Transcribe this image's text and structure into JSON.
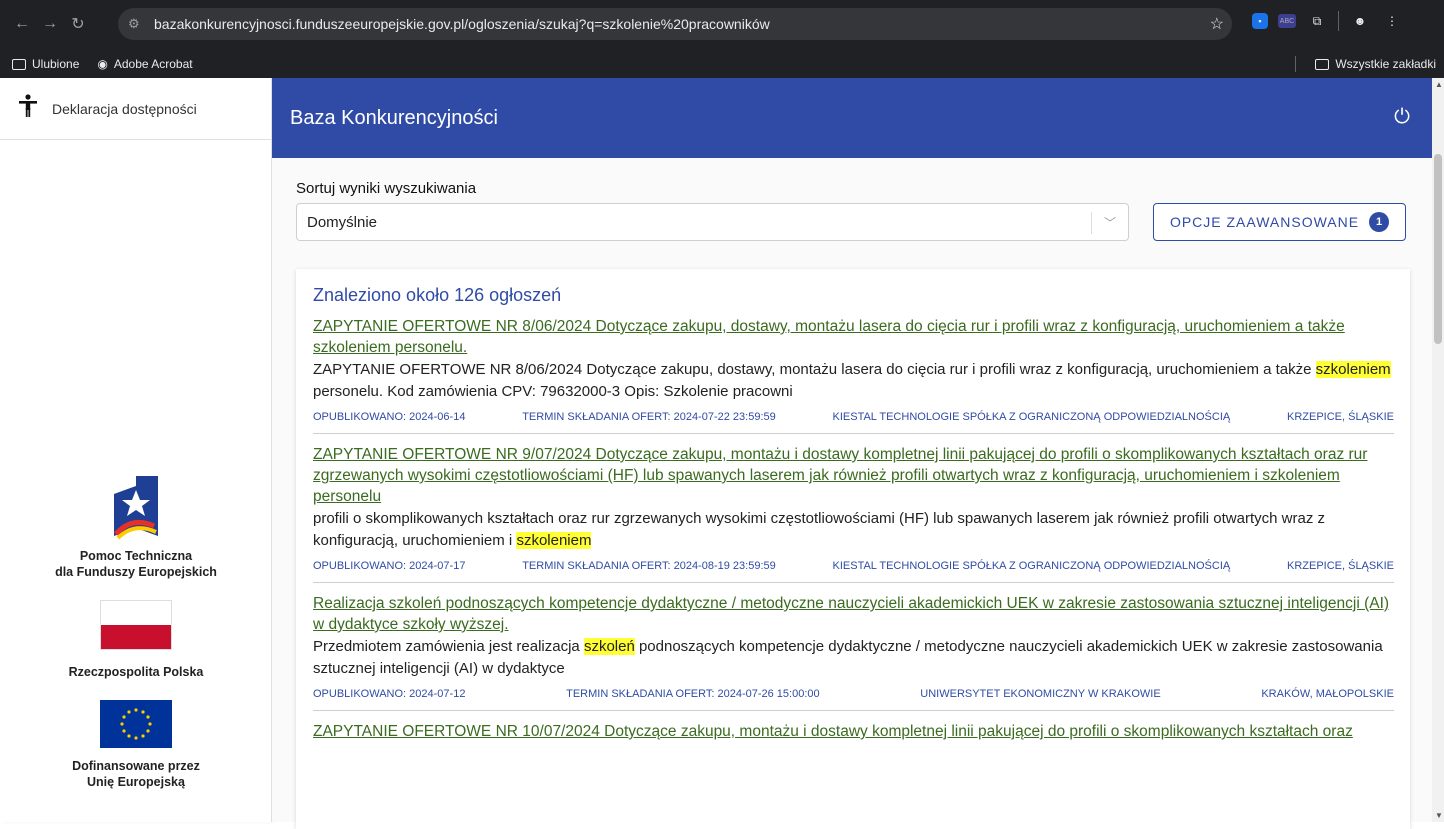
{
  "browser": {
    "url": "bazakonkurencyjnosci.funduszeeuropejskie.gov.pl/ogloszenia/szukaj?q=szkolenie%20pracowników",
    "bookmarks": [
      {
        "label": "Ulubione",
        "icon": "folder-icon"
      },
      {
        "label": "Adobe Acrobat",
        "icon": "adobe-acrobat-icon"
      }
    ],
    "all_bookmarks_label": "Wszystkie zakładki"
  },
  "sidebar": {
    "accessibility_label": "Deklaracja dostępności",
    "logos": [
      {
        "line1": "Pomoc Techniczna",
        "line2": "dla Funduszy Europejskich"
      },
      {
        "line1": "Rzeczpospolita Polska",
        "line2": ""
      },
      {
        "line1": "Dofinansowane przez",
        "line2": "Unię Europejską"
      }
    ]
  },
  "header": {
    "title": "Baza Konkurencyjności"
  },
  "controls": {
    "sort_label": "Sortuj wyniki wyszukiwania",
    "sort_value": "Domyślnie",
    "advanced_label": "OPCJE ZAAWANSOWANE",
    "advanced_count": "1"
  },
  "results": {
    "found_text": "Znaleziono około 126 ogłoszeń",
    "items": [
      {
        "title": "ZAPYTANIE OFERTOWE NR 8/06/2024 Dotyczące zakupu, dostawy, montażu lasera do cięcia rur i profili wraz z konfiguracją, uruchomieniem a także szkoleniem personelu.",
        "desc_before": "ZAPYTANIE OFERTOWE NR 8/06/2024 Dotyczące zakupu, dostawy, montażu lasera do cięcia rur i profili wraz z konfiguracją, uruchomieniem a także ",
        "desc_highlight": "szkoleniem",
        "desc_after": " personelu. Kod zamówienia CPV: 79632000-3 Opis: Szkolenie pracowni",
        "published": "OPUBLIKOWANO: 2024-06-14",
        "deadline": "TERMIN SKŁADANIA OFERT: 2024-07-22 23:59:59",
        "organization": "KIESTAL TECHNOLOGIE SPÓŁKA Z OGRANICZONĄ ODPOWIEDZIALNOŚCIĄ",
        "location": "KRZEPICE, ŚLĄSKIE"
      },
      {
        "title": "ZAPYTANIE OFERTOWE NR 9/07/2024 Dotyczące zakupu, montażu i dostawy kompletnej linii pakującej do profili o skomplikowanych kształtach oraz rur zgrzewanych wysokimi częstotliowościami (HF) lub spawanych laserem jak również profili otwartych wraz z konfiguracją, uruchomieniem i szkoleniem personelu",
        "desc_before": "profili o skomplikowanych kształtach oraz rur zgrzewanych wysokimi częstotliowościami (HF) lub spawanych laserem jak również profili otwartych wraz z konfiguracją, uruchomieniem i ",
        "desc_highlight": "szkoleniem",
        "desc_after": "",
        "published": "OPUBLIKOWANO: 2024-07-17",
        "deadline": "TERMIN SKŁADANIA OFERT: 2024-08-19 23:59:59",
        "organization": "KIESTAL TECHNOLOGIE SPÓŁKA Z OGRANICZONĄ ODPOWIEDZIALNOŚCIĄ",
        "location": "KRZEPICE, ŚLĄSKIE"
      },
      {
        "title": "Realizacja szkoleń podnoszących kompetencje dydaktyczne / metodyczne nauczycieli akademickich UEK w zakresie zastosowania sztucznej inteligencji (AI) w dydaktyce szkoły wyższej.",
        "desc_before": "Przedmiotem zamówienia jest realizacja ",
        "desc_highlight": "szkoleń",
        "desc_after": " podnoszących kompetencje dydaktyczne / metodyczne nauczycieli akademickich UEK w zakresie zastosowania sztucznej inteligencji (AI) w dydaktyce",
        "published": "OPUBLIKOWANO: 2024-07-12",
        "deadline": "TERMIN SKŁADANIA OFERT: 2024-07-26 15:00:00",
        "organization": "UNIWERSYTET EKONOMICZNY W KRAKOWIE",
        "location": "KRAKÓW, MAŁOPOLSKIE"
      },
      {
        "title": "ZAPYTANIE OFERTOWE NR 10/07/2024 Dotyczące zakupu, montażu i dostawy kompletnej linii pakującej do profili o skomplikowanych kształtach oraz",
        "desc_before": "",
        "desc_highlight": "",
        "desc_after": "",
        "published": "",
        "deadline": "",
        "organization": "",
        "location": ""
      }
    ]
  },
  "colors": {
    "header_blue": "#2f4ba6",
    "link_green": "#3a6b1f",
    "highlight_yellow": "#ffff33"
  }
}
